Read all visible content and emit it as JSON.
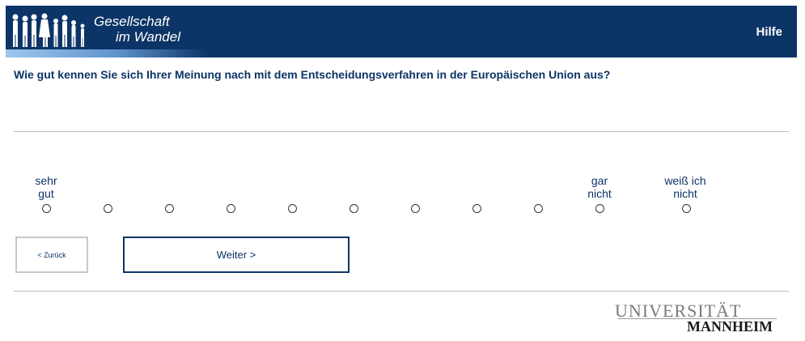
{
  "header": {
    "logo_line1": "Gesellschaft",
    "logo_line2": "im Wandel",
    "help_label": "Hilfe",
    "background_color": "#0c3466"
  },
  "question": {
    "text": "Wie gut kennen Sie sich Ihrer Meinung nach mit dem Entscheidungsverfahren in der Europäischen Union aus?"
  },
  "scale": {
    "left_anchor_line1": "sehr",
    "left_anchor_line2": "gut",
    "right_anchor_line1": "gar",
    "right_anchor_line2": "nicht",
    "dk_line1": "weiß ich",
    "dk_line2": "nicht",
    "option_count": 11,
    "selected": null
  },
  "buttons": {
    "back_label": "< Zurück",
    "next_label": "Weiter >"
  },
  "footer": {
    "uni_line1": "UNIVERSITÄT",
    "uni_line2": "MANNHEIM"
  }
}
